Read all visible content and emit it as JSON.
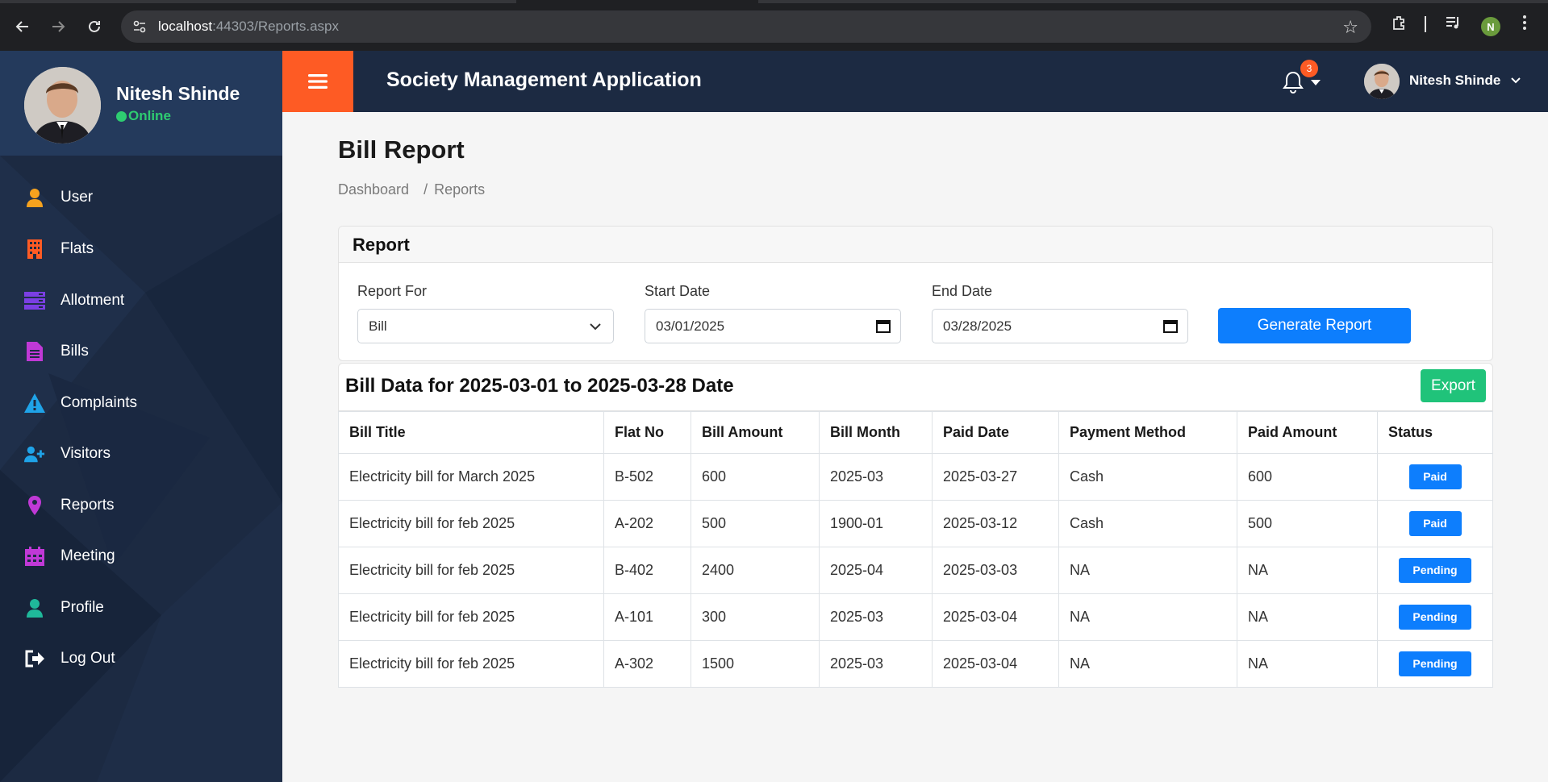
{
  "browser": {
    "url_host": "localhost",
    "url_rest": ":44303/Reports.aspx",
    "profile_initial": "N"
  },
  "sidebar": {
    "user_name": "Nitesh Shinde",
    "status": "Online",
    "items": [
      {
        "label": "User",
        "icon": "user-icon",
        "color": "#f6a21e"
      },
      {
        "label": "Flats",
        "icon": "building-icon",
        "color": "#fe5b24"
      },
      {
        "label": "Allotment",
        "icon": "allotment-icon",
        "color": "#7b3fe4"
      },
      {
        "label": "Bills",
        "icon": "bill-icon",
        "color": "#c039d6"
      },
      {
        "label": "Complaints",
        "icon": "warning-icon",
        "color": "#1fa3e8"
      },
      {
        "label": "Visitors",
        "icon": "add-user-icon",
        "color": "#1fa3e8"
      },
      {
        "label": "Reports",
        "icon": "map-pin-icon",
        "color": "#c039d6"
      },
      {
        "label": "Meeting",
        "icon": "calendar-icon",
        "color": "#c039d6"
      },
      {
        "label": "Profile",
        "icon": "profile-icon",
        "color": "#1fb89a"
      },
      {
        "label": "Log Out",
        "icon": "logout-icon",
        "color": "#ffffff"
      }
    ]
  },
  "header": {
    "app_title": "Society Management Application",
    "notification_count": "3",
    "user_name": "Nitesh Shinde",
    "accent": "#fe5b24"
  },
  "page": {
    "title": "Bill Report",
    "breadcrumb": [
      "Dashboard",
      "Reports"
    ]
  },
  "report": {
    "card_title": "Report",
    "report_for_label": "Report For",
    "report_for_value": "Bill",
    "start_date_label": "Start Date",
    "start_date_value": "03/01/2025",
    "end_date_label": "End Date",
    "end_date_value": "03/28/2025",
    "generate_label": "Generate Report"
  },
  "data": {
    "title": "Bill Data for 2025-03-01 to 2025-03-28 Date",
    "export_label": "Export",
    "columns": [
      "Bill Title",
      "Flat No",
      "Bill Amount",
      "Bill Month",
      "Paid Date",
      "Payment Method",
      "Paid Amount",
      "Status"
    ],
    "rows": [
      [
        "Electricity bill for March 2025",
        "B-502",
        "600",
        "2025-03",
        "2025-03-27",
        "Cash",
        "600",
        "Paid"
      ],
      [
        "Electricity bill for feb 2025",
        "A-202",
        "500",
        "1900-01",
        "2025-03-12",
        "Cash",
        "500",
        "Paid"
      ],
      [
        "Electricity bill for feb 2025",
        "B-402",
        "2400",
        "2025-04",
        "2025-03-03",
        "NA",
        "NA",
        "Pending"
      ],
      [
        "Electricity bill for feb 2025",
        "A-101",
        "300",
        "2025-03",
        "2025-03-04",
        "NA",
        "NA",
        "Pending"
      ],
      [
        "Electricity bill for feb 2025",
        "A-302",
        "1500",
        "2025-03",
        "2025-03-04",
        "NA",
        "NA",
        "Pending"
      ]
    ]
  }
}
